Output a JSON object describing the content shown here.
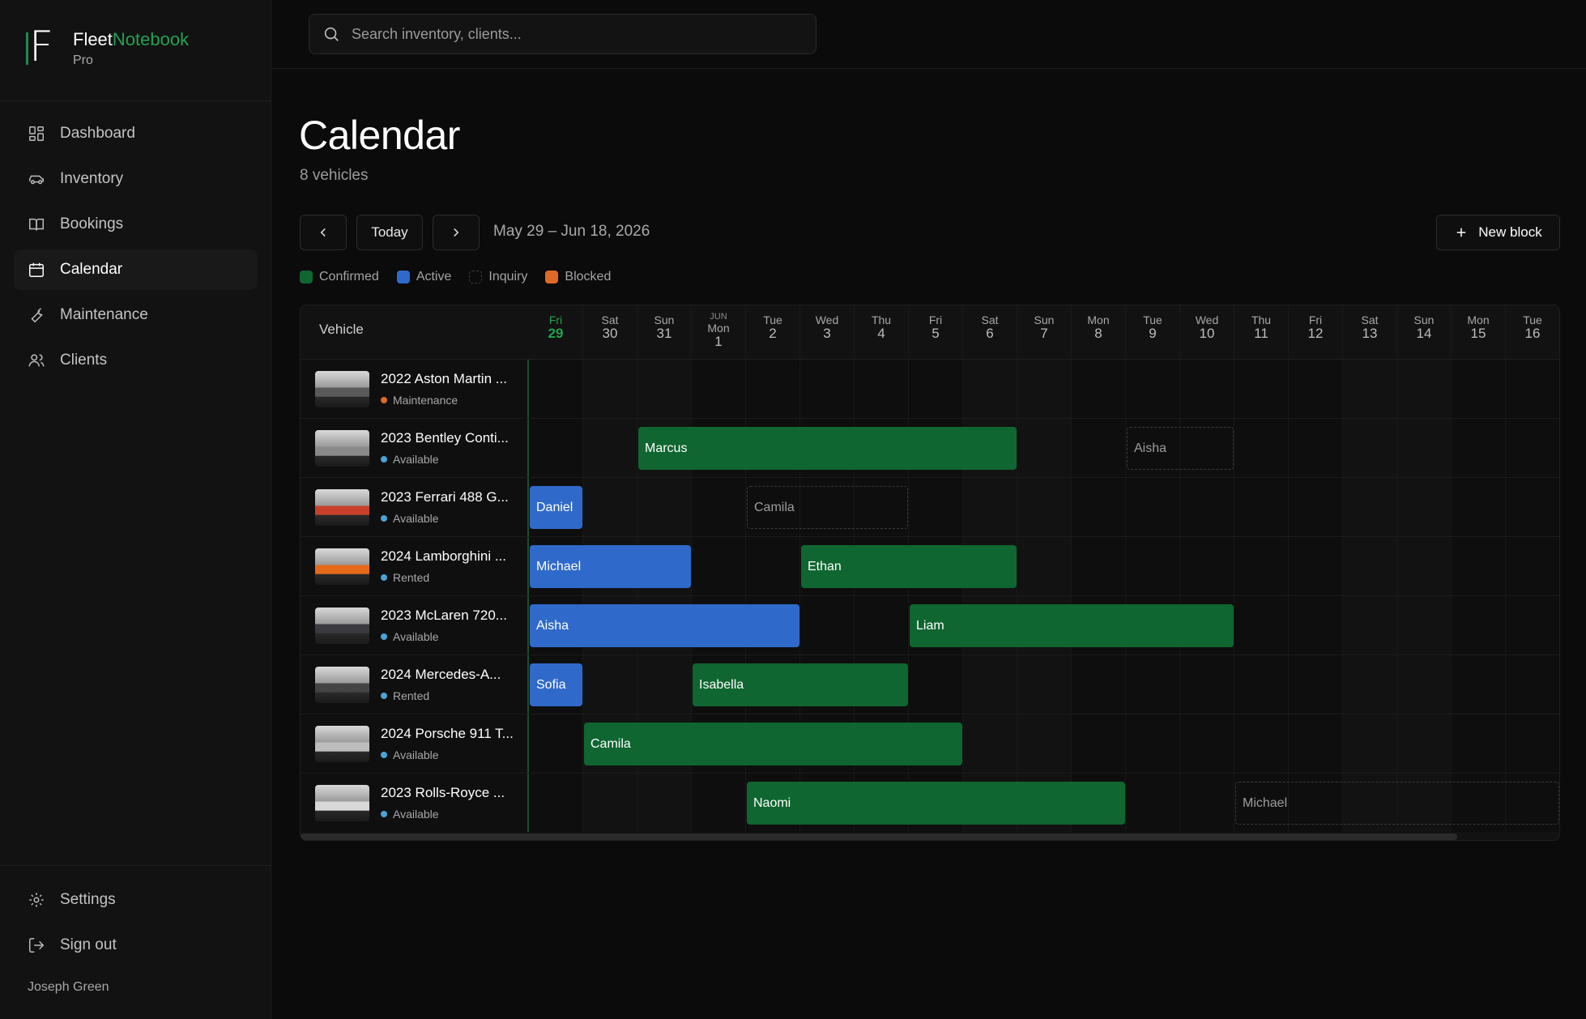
{
  "brand": {
    "name_a": "Fleet",
    "name_b": "Notebook",
    "tier": "Pro",
    "mark": "F"
  },
  "nav": [
    {
      "label": "Dashboard",
      "icon": "grid-icon"
    },
    {
      "label": "Inventory",
      "icon": "car-icon"
    },
    {
      "label": "Bookings",
      "icon": "book-icon"
    },
    {
      "label": "Calendar",
      "icon": "calendar-icon",
      "active": true
    },
    {
      "label": "Maintenance",
      "icon": "wrench-icon"
    },
    {
      "label": "Clients",
      "icon": "users-icon"
    }
  ],
  "nav_bottom": [
    {
      "label": "Settings",
      "icon": "gear-icon"
    },
    {
      "label": "Sign out",
      "icon": "sign-out-icon"
    }
  ],
  "user": {
    "name": "Joseph Green"
  },
  "search": {
    "placeholder": "Search inventory, clients..."
  },
  "page": {
    "title": "Calendar",
    "subtitle": "8 vehicles"
  },
  "controls": {
    "today": "Today",
    "range": "May 29 – Jun 18, 2026",
    "new_block": "New block"
  },
  "legend": [
    {
      "label": "Confirmed",
      "color": "#0f6630"
    },
    {
      "label": "Active",
      "color": "#2f6acb"
    },
    {
      "label": "Inquiry",
      "color": "transparent"
    },
    {
      "label": "Blocked",
      "color": "#e06a25"
    }
  ],
  "grid": {
    "vehicle_header": "Vehicle",
    "days": [
      {
        "dow": "Fri",
        "num": "29",
        "today": true
      },
      {
        "dow": "Sat",
        "num": "30"
      },
      {
        "dow": "Sun",
        "num": "31"
      },
      {
        "month": "JUN",
        "dow": "Mon",
        "num": "1"
      },
      {
        "dow": "Tue",
        "num": "2"
      },
      {
        "dow": "Wed",
        "num": "3"
      },
      {
        "dow": "Thu",
        "num": "4"
      },
      {
        "dow": "Fri",
        "num": "5"
      },
      {
        "dow": "Sat",
        "num": "6"
      },
      {
        "dow": "Sun",
        "num": "7"
      },
      {
        "dow": "Mon",
        "num": "8"
      },
      {
        "dow": "Tue",
        "num": "9"
      },
      {
        "dow": "Wed",
        "num": "10"
      },
      {
        "dow": "Thu",
        "num": "11"
      },
      {
        "dow": "Fri",
        "num": "12"
      },
      {
        "dow": "Sat",
        "num": "13"
      },
      {
        "dow": "Sun",
        "num": "14"
      },
      {
        "dow": "Mon",
        "num": "15"
      },
      {
        "dow": "Tue",
        "num": "16"
      }
    ],
    "vehicles": [
      {
        "name": "2022 Aston Martin ...",
        "status": "Maintenance",
        "status_color": "#e06a25",
        "thumb": "#5a5a5a"
      },
      {
        "name": "2023 Bentley Conti...",
        "status": "Available",
        "status_color": "#4aa3d8",
        "thumb": "#8a8a8a"
      },
      {
        "name": "2023 Ferrari 488 G...",
        "status": "Available",
        "status_color": "#4aa3d8",
        "thumb": "#c8402a"
      },
      {
        "name": "2024 Lamborghini ...",
        "status": "Rented",
        "status_color": "#4aa3d8",
        "thumb": "#e46a1a"
      },
      {
        "name": "2023 McLaren 720...",
        "status": "Available",
        "status_color": "#4aa3d8",
        "thumb": "#3a3a40"
      },
      {
        "name": "2024 Mercedes-A...",
        "status": "Rented",
        "status_color": "#4aa3d8",
        "thumb": "#444444"
      },
      {
        "name": "2024 Porsche 911 T...",
        "status": "Available",
        "status_color": "#4aa3d8",
        "thumb": "#bdbdbd"
      },
      {
        "name": "2023 Rolls-Royce ...",
        "status": "Available",
        "status_color": "#4aa3d8",
        "thumb": "#d8d8d8"
      }
    ],
    "bookings": [
      {
        "row": 1,
        "start": 2,
        "end": 9,
        "client": "Marcus",
        "type": "confirmed"
      },
      {
        "row": 1,
        "start": 11,
        "end": 13,
        "client": "Aisha",
        "type": "inquiry"
      },
      {
        "row": 2,
        "start": 0,
        "end": 1,
        "client": "Daniel",
        "type": "active"
      },
      {
        "row": 2,
        "start": 4,
        "end": 7,
        "client": "Camila",
        "type": "inquiry"
      },
      {
        "row": 3,
        "start": 0,
        "end": 3,
        "client": "Michael",
        "type": "active"
      },
      {
        "row": 3,
        "start": 5,
        "end": 9,
        "client": "Ethan",
        "type": "confirmed"
      },
      {
        "row": 4,
        "start": 0,
        "end": 5,
        "client": "Aisha",
        "type": "active"
      },
      {
        "row": 4,
        "start": 7,
        "end": 13,
        "client": "Liam",
        "type": "confirmed"
      },
      {
        "row": 5,
        "start": 0,
        "end": 1,
        "client": "Sofia",
        "type": "active"
      },
      {
        "row": 5,
        "start": 3,
        "end": 7,
        "client": "Isabella",
        "type": "confirmed"
      },
      {
        "row": 6,
        "start": 1,
        "end": 8,
        "client": "Camila",
        "type": "confirmed"
      },
      {
        "row": 7,
        "start": 4,
        "end": 11,
        "client": "Naomi",
        "type": "confirmed"
      },
      {
        "row": 7,
        "start": 13,
        "end": 19,
        "client": "Michael",
        "type": "inquiry"
      }
    ]
  }
}
